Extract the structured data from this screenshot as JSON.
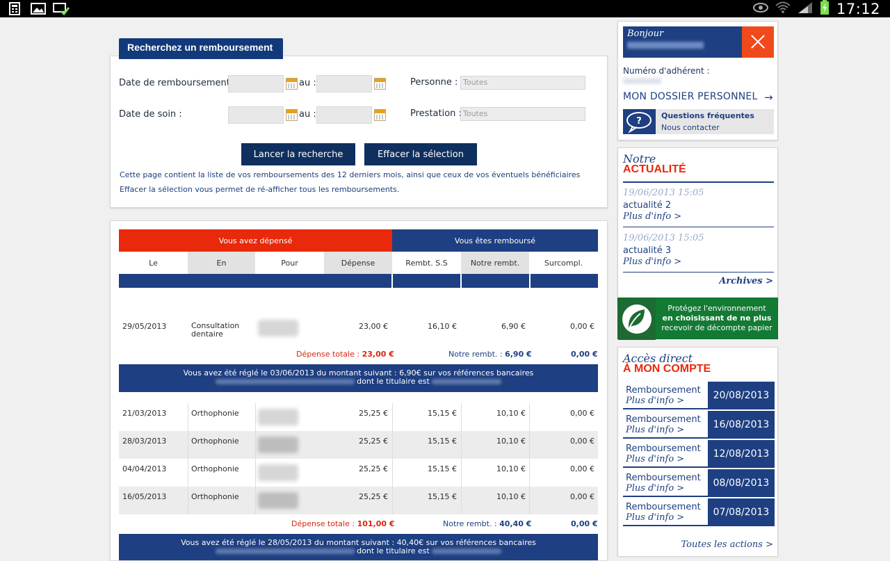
{
  "statusbar": {
    "time": "17:12"
  },
  "search": {
    "tab_title": "Recherchez un remboursement",
    "date_remb_label": "Date de remboursement :",
    "date_soin_label": "Date de soin :",
    "au_label": "au :",
    "personne_label": "Personne :",
    "prestation_label": "Prestation :",
    "personne_placeholder": "Toutes",
    "prestation_placeholder": "Toutes",
    "btn_search": "Lancer la recherche",
    "btn_clear": "Effacer la sélection",
    "info1": "Cette page contient la liste de vos remboursements des 12 derniers mois, ainsi que ceux de vos éventuels bénéficiaires",
    "info2": "Effacer la sélection vous permet de ré-afficher tous les remboursements."
  },
  "table": {
    "hdr_depense": "Vous avez dépensé",
    "hdr_rembourse": "Vous êtes remboursé",
    "cols": [
      "Le",
      "En",
      "Pour",
      "Dépense",
      "Rembt. S.S",
      "Notre rembt.",
      "Surcompl."
    ],
    "group1": {
      "rows": [
        {
          "date": "29/05/2013",
          "en": "Consultation dentaire",
          "depense": "23,00 €",
          "ss": "16,10 €",
          "notre": "6,90 €",
          "surc": "0,00 €"
        }
      ],
      "total_dep_label": "Dépense totale :",
      "total_dep": "23,00 €",
      "total_notre_label": "Notre rembt. :",
      "total_notre": "6,90 €",
      "total_surc": "0,00 €",
      "bandeau1": "Vous avez été réglé le 03/06/2013 du montant suivant : 6,90€ sur vos références bancaires",
      "bandeau2": "dont le titulaire est"
    },
    "group2": {
      "rows": [
        {
          "date": "21/03/2013",
          "en": "Orthophonie",
          "depense": "25,25 €",
          "ss": "15,15 €",
          "notre": "10,10 €",
          "surc": "0,00 €"
        },
        {
          "date": "28/03/2013",
          "en": "Orthophonie",
          "depense": "25,25 €",
          "ss": "15,15 €",
          "notre": "10,10 €",
          "surc": "0,00 €"
        },
        {
          "date": "04/04/2013",
          "en": "Orthophonie",
          "depense": "25,25 €",
          "ss": "15,15 €",
          "notre": "10,10 €",
          "surc": "0,00 €"
        },
        {
          "date": "16/05/2013",
          "en": "Orthophonie",
          "depense": "25,25 €",
          "ss": "15,15 €",
          "notre": "10,10 €",
          "surc": "0,00 €"
        }
      ],
      "total_dep_label": "Dépense totale :",
      "total_dep": "101,00 €",
      "total_notre_label": "Notre rembt. :",
      "total_notre": "40,40 €",
      "total_surc": "0,00 €",
      "bandeau1": "Vous avez été réglé le 28/05/2013 du montant suivant : 40,40€ sur vos références bancaires",
      "bandeau2": "dont le titulaire est"
    }
  },
  "sidebar": {
    "bonjour": "Bonjour",
    "numero_label": "Numéro d'adhérent :",
    "dossier": "MON DOSSIER PERSONNEL",
    "faq": "Questions fréquentes",
    "contact": "Nous contacter",
    "actu_title1": "Notre",
    "actu_title2": "ACTUALITÉ",
    "news": [
      {
        "date": "19/06/2013 15:05",
        "title": "actualité 2",
        "more": "Plus d'info >"
      },
      {
        "date": "19/06/2013 15:05",
        "title": "actualité 3",
        "more": "Plus d'info >"
      }
    ],
    "archives": "Archives >",
    "eco_line1": "Protégez l'environnement",
    "eco_line2": "en choisissant de ne plus",
    "eco_line3": "recevoir de décompte papier",
    "acces_title1": "Accès direct",
    "acces_title2": "À MON COMPTE",
    "acces_items": [
      {
        "label": "Remboursement",
        "more": "Plus d'info >",
        "date": "20/08/2013"
      },
      {
        "label": "Remboursement",
        "more": "Plus d'info >",
        "date": "16/08/2013"
      },
      {
        "label": "Remboursement",
        "more": "Plus d'info >",
        "date": "12/08/2013"
      },
      {
        "label": "Remboursement",
        "more": "Plus d'info >",
        "date": "08/08/2013"
      },
      {
        "label": "Remboursement",
        "more": "Plus d'info >",
        "date": "07/08/2013"
      }
    ],
    "toutes_actions": "Toutes les actions >"
  }
}
